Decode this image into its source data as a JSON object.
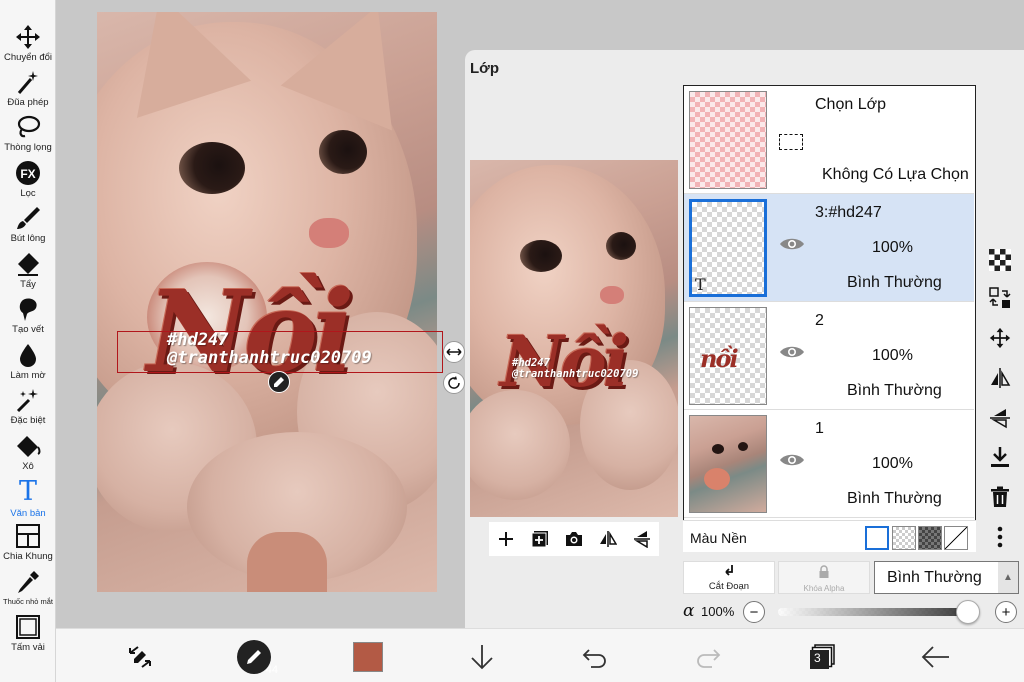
{
  "toolbar": {
    "tools": [
      {
        "label": "Chuyển đổi",
        "icon": "move-arrows-icon"
      },
      {
        "label": "Đũa phép",
        "icon": "magic-wand-icon"
      },
      {
        "label": "Thòng lọng",
        "icon": "lasso-icon"
      },
      {
        "label": "Lọc",
        "icon": "fx-filter-icon",
        "badge": "FX"
      },
      {
        "label": "Bút lông",
        "icon": "brush-icon"
      },
      {
        "label": "Tẩy",
        "icon": "eraser-icon"
      },
      {
        "label": "Tạo vết",
        "icon": "smudge-icon"
      },
      {
        "label": "Làm mờ",
        "icon": "blur-drop-icon"
      },
      {
        "label": "Đặc biệt",
        "icon": "sparkle-icon"
      },
      {
        "label": "Xô",
        "icon": "bucket-icon"
      },
      {
        "label": "Văn bản",
        "icon": "text-icon",
        "glyph": "T",
        "active": true
      },
      {
        "label": "Chia Khung",
        "icon": "frame-divider-icon"
      },
      {
        "label": "Thuốc nhỏ mắt",
        "icon": "eyedropper-icon"
      },
      {
        "label": "Tấm vải",
        "icon": "canvas-icon"
      }
    ],
    "active_color": "#1a73e8"
  },
  "canvas": {
    "big_word": "Nồi",
    "tag_line1": "#hd247",
    "tag_line2": "@tranthanhtruc020709"
  },
  "layer_panel": {
    "title": "Lớp",
    "selection_row": {
      "name": "Chọn Lớp",
      "status": "Không Có Lựa Chọn"
    },
    "layers": [
      {
        "name": "3:#hd247",
        "opacity": "100%",
        "blend": "Bình Thường",
        "selected": true,
        "thumb_glyph": "T"
      },
      {
        "name": "2",
        "opacity": "100%",
        "blend": "Bình Thường",
        "selected": false,
        "thumb_glyph": "nồi"
      },
      {
        "name": "1",
        "opacity": "100%",
        "blend": "Bình Thường",
        "selected": false
      }
    ],
    "background_label": "Màu Nền",
    "cut_label": "Cắt Đoạn",
    "alpha_lock_label": "Khóa Alpha",
    "blend_mode": "Bình Thường",
    "alpha_symbol": "α",
    "alpha_value": "100%",
    "alpha_fraction": 1.0,
    "minus": "−",
    "plus": "+",
    "selected_color": "#d6e3f5",
    "accent_color": "#1a6fd8"
  },
  "bottom_bar": {
    "brush_size": "44",
    "current_color": "#b35a45",
    "layer_count": "3"
  }
}
